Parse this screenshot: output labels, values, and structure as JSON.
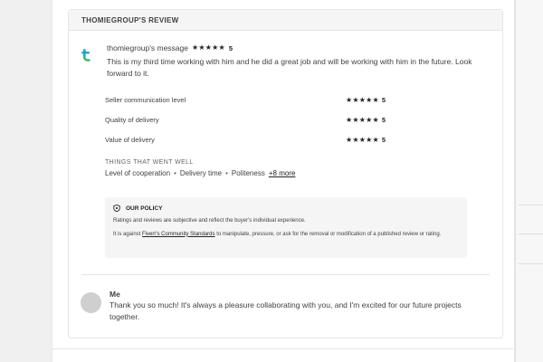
{
  "review": {
    "header": "THOMIEGROUP'S REVIEW",
    "reviewer": {
      "logo_icon": "thomiegroup-logo-icon",
      "title": "thomiegroup's message",
      "stars": "★★★★★",
      "score": "5",
      "message": "This is my third time working with him and he did a great job and will be working with him in the future. Look forward to it."
    },
    "ratings": [
      {
        "label": "Seller communication level",
        "stars": "★★★★★",
        "score": "5"
      },
      {
        "label": "Quality of delivery",
        "stars": "★★★★★",
        "score": "5"
      },
      {
        "label": "Value of delivery",
        "stars": "★★★★★",
        "score": "5"
      }
    ],
    "went_well": {
      "heading": "THINGS THAT WENT WELL",
      "tags": [
        "Level of cooperation",
        "Delivery time",
        "Politeness"
      ],
      "separator": "•",
      "more": "+8 more"
    },
    "policy": {
      "icon": "shield-icon",
      "heading": "OUR POLICY",
      "p1": "Ratings and reviews are subjective and reflect the buyer's individual experience.",
      "p2_before": "It is against ",
      "p2_link": "Fiverr's Community Standards",
      "p2_after": " to manipulate, pressure, or ask for the removal or modification of a published review or rating."
    },
    "reply": {
      "name": "Me",
      "text": "Thank you so much! It's always a pleasure collaborating with you, and I'm excited for our future projects together."
    }
  },
  "colors": {
    "text": "#404145",
    "muted": "#62646a",
    "policy_bg": "#f5f5f5",
    "logo_blue": "#1aa3d9",
    "logo_green": "#3bb273"
  }
}
